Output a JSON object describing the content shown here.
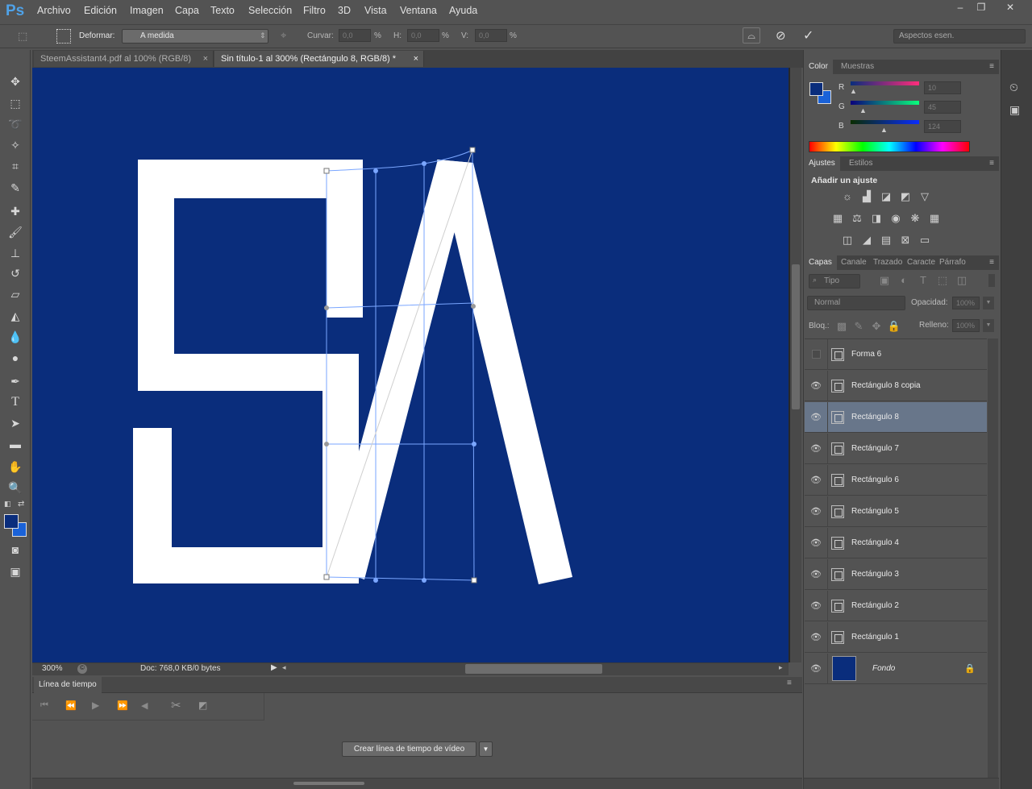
{
  "app": {
    "logo": "Ps"
  },
  "menu": [
    "Archivo",
    "Edición",
    "Imagen",
    "Capa",
    "Texto",
    "Selección",
    "Filtro",
    "3D",
    "Vista",
    "Ventana",
    "Ayuda"
  ],
  "window_buttons": [
    "–",
    "❐",
    "✕"
  ],
  "options": {
    "warp_label": "Deformar:",
    "warp_value": "A medida",
    "curve_label": "Curvar:",
    "curve_value": "0,0",
    "h_label": "H:",
    "h_value": "0,0",
    "v_label": "V:",
    "v_value": "0,0",
    "percent": "%",
    "workspace": "Aspectos esen."
  },
  "tabs": [
    {
      "label": "SteemAssistant4.pdf al 100% (RGB/8)",
      "close": "×"
    },
    {
      "label": "Sin título-1 al 300% (Rectángulo 8, RGB/8) *",
      "close": "×"
    }
  ],
  "document": {
    "background": "#0a2d7c",
    "shape_color": "#ffffff"
  },
  "status": {
    "zoom": "300%",
    "doc": "Doc: 768,0 KB/0 bytes"
  },
  "timeline": {
    "title": "Línea de tiempo",
    "create_button": "Crear línea de tiempo de vídeo"
  },
  "color_panel": {
    "tabs": [
      "Color",
      "Muestras"
    ],
    "r_label": "R",
    "r_value": "10",
    "g_label": "G",
    "g_value": "45",
    "b_label": "B",
    "b_value": "124",
    "fg": "#0a2d7c",
    "bg": "#1a62d8"
  },
  "adjust_panel": {
    "tabs": [
      "Ajustes",
      "Estilos"
    ],
    "heading": "Añadir un ajuste"
  },
  "layers_panel": {
    "tabs": [
      "Capas",
      "Canales",
      "Trazados",
      "Caracte",
      "Párrafo"
    ],
    "filter": "Tipo",
    "blend": "Normal",
    "opacity_label": "Opacidad:",
    "opacity_value": "100%",
    "lock_label": "Bloq.:",
    "fill_label": "Relleno:",
    "fill_value": "100%",
    "layers": [
      {
        "name": "Forma 6",
        "visible": false,
        "selected": false
      },
      {
        "name": "Rectángulo 8 copia",
        "visible": true,
        "selected": false
      },
      {
        "name": "Rectángulo 8",
        "visible": true,
        "selected": true
      },
      {
        "name": "Rectángulo 7",
        "visible": true,
        "selected": false
      },
      {
        "name": "Rectángulo 6",
        "visible": true,
        "selected": false
      },
      {
        "name": "Rectángulo 5",
        "visible": true,
        "selected": false
      },
      {
        "name": "Rectángulo 4",
        "visible": true,
        "selected": false
      },
      {
        "name": "Rectángulo 3",
        "visible": true,
        "selected": false
      },
      {
        "name": "Rectángulo 2",
        "visible": true,
        "selected": false
      },
      {
        "name": "Rectángulo 1",
        "visible": true,
        "selected": false
      },
      {
        "name": "Fondo",
        "visible": true,
        "selected": false
      }
    ]
  }
}
